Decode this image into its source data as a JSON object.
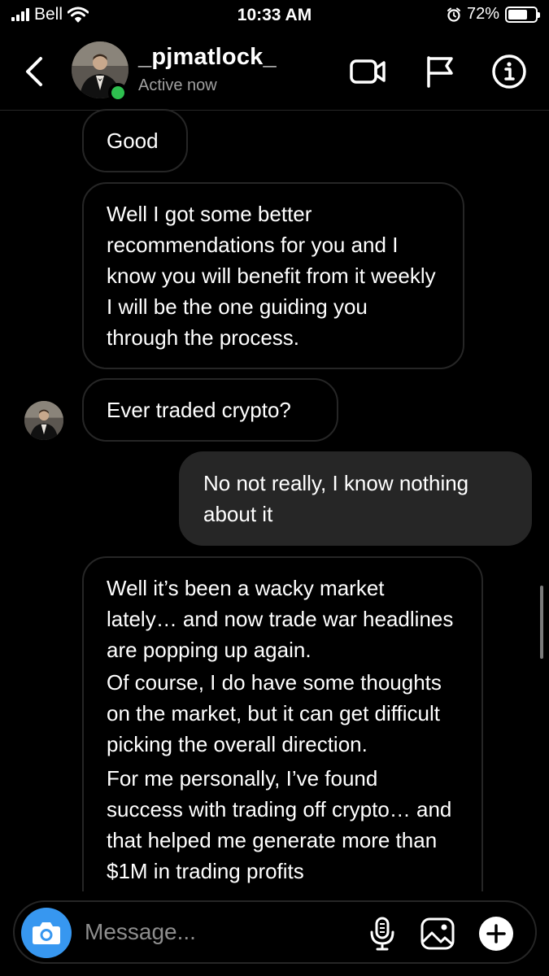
{
  "status_bar": {
    "carrier": "Bell",
    "time": "10:33 AM",
    "battery_percent": "72%",
    "battery_level": 0.72,
    "icons": [
      "signal-icon",
      "wifi-icon",
      "alarm-icon",
      "battery-icon"
    ]
  },
  "header": {
    "username": "_pjmatlock_",
    "status": "Active now",
    "icons": [
      "back-chevron-icon",
      "video-camera-icon",
      "flag-icon",
      "info-icon"
    ]
  },
  "messages": [
    {
      "from": "them",
      "text": "Good"
    },
    {
      "from": "them",
      "text": "Well I got some better recommendations for you and I know you will benefit from it weekly I will be the one guiding you through the process."
    },
    {
      "from": "them",
      "text": "Ever traded crypto?"
    },
    {
      "from": "me",
      "text": "No not really, I know nothing about it"
    },
    {
      "from": "them",
      "paragraphs": [
        "Well it’s been a wacky market lately… and now trade war headlines are popping up again.",
        "Of course, I do have some thoughts on the market, but it can get difficult picking the overall direction.",
        "For me personally, I’ve found success with trading off crypto… and that helped me generate more than $1M in trading profits"
      ]
    }
  ],
  "composer": {
    "placeholder": "Message...",
    "icons": [
      "camera-icon",
      "microphone-icon",
      "image-icon",
      "plus-icon"
    ]
  },
  "colors": {
    "background": "#000000",
    "bubble_border": "#262626",
    "sent_bubble": "#262626",
    "accent_blue": "#3797f0",
    "active_green": "#2ec04f"
  }
}
